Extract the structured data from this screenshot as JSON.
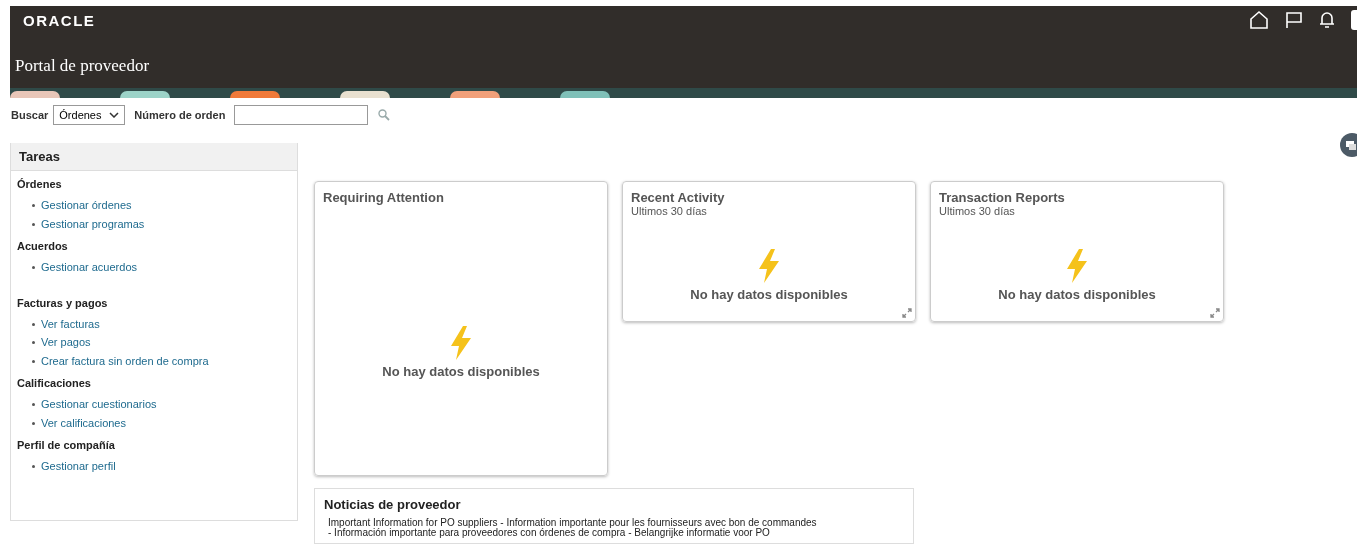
{
  "header": {
    "logo": "ORACLE",
    "title": "Portal de proveedor"
  },
  "search": {
    "label": "Buscar",
    "dropdown": "Órdenes",
    "field_label": "Número de orden"
  },
  "tasks": {
    "title": "Tareas",
    "groups": [
      {
        "heading": "Órdenes",
        "links": [
          "Gestionar órdenes",
          "Gestionar programas"
        ]
      },
      {
        "heading": "Acuerdos",
        "links": [
          "Gestionar acuerdos"
        ]
      },
      {
        "heading": "Facturas y pagos",
        "links": [
          "Ver facturas",
          "Ver pagos",
          "Crear factura sin orden de compra"
        ]
      },
      {
        "heading": "Calificaciones",
        "links": [
          "Gestionar cuestionarios",
          "Ver calificaciones"
        ]
      },
      {
        "heading": "Perfil de compañía",
        "links": [
          "Gestionar perfil"
        ]
      }
    ]
  },
  "cards": [
    {
      "title": "Requiring Attention",
      "message": "No hay datos disponibles",
      "kind": "tall"
    },
    {
      "title": "Recent Activity",
      "subtitle": "Ultimos 30 días",
      "message": "No hay datos disponibles",
      "kind": "short"
    },
    {
      "title": "Transaction Reports",
      "subtitle": "Ultimos 30 días",
      "message": "No hay datos disponibles",
      "kind": "short"
    }
  ],
  "news": {
    "title": "Noticias de proveedor",
    "lines": [
      "Important Information for PO suppliers - Information importante pour les fournisseurs avec bon de commandes",
      "- Información importante para proveedores con órdenes de compra - Belangrijke informatie voor PO"
    ]
  }
}
